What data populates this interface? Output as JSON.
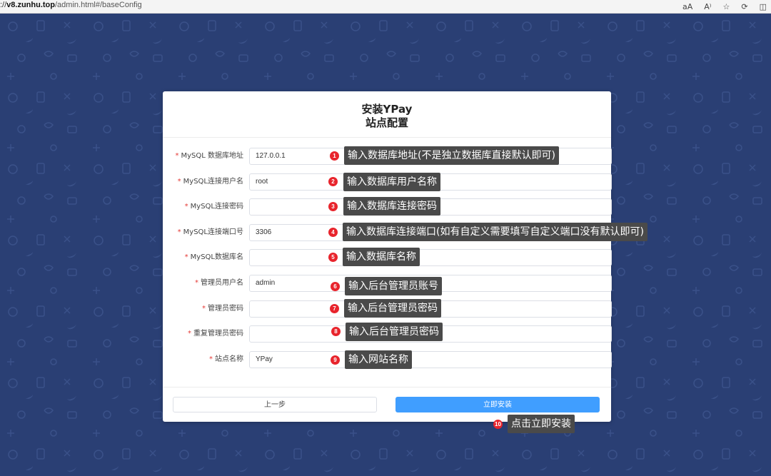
{
  "browser": {
    "url_prefix": "://",
    "url_host": "v8.zunhu.top",
    "url_rest": "/admin.html#/baseConfig",
    "icons": [
      "read-aloud-icon",
      "text-size-icon",
      "favorite-star-icon",
      "extensions-icon",
      "split-screen-icon"
    ]
  },
  "card": {
    "title": "安装YPay",
    "subtitle": "站点配置"
  },
  "form": {
    "required_mark": "*",
    "fields": [
      {
        "label": "MySQL 数据库地址",
        "value": "127.0.0.1"
      },
      {
        "label": "MySQL连接用户名",
        "value": "root"
      },
      {
        "label": "MySQL连接密码",
        "value": ""
      },
      {
        "label": "MySQL连接端口号",
        "value": "3306"
      },
      {
        "label": "MySQL数据库名",
        "value": ""
      },
      {
        "label": "管理员用户名",
        "value": "admin"
      },
      {
        "label": "管理员密码",
        "value": ""
      },
      {
        "label": "重复管理员密码",
        "value": ""
      },
      {
        "label": "站点名称",
        "value": "YPay"
      }
    ]
  },
  "buttons": {
    "prev": "上一步",
    "install": "立即安装"
  },
  "annotations": [
    {
      "num": "1",
      "text": "输入数据库地址(不是独立数据库直接默认即可)"
    },
    {
      "num": "2",
      "text": "输入数据库用户名称"
    },
    {
      "num": "3",
      "text": "输入数据库连接密码"
    },
    {
      "num": "4",
      "text": "输入数据库连接端口(如有自定义需要填写自定义端口没有默认即可)"
    },
    {
      "num": "5",
      "text": "输入数据库名称"
    },
    {
      "num": "6",
      "text": "输入后台管理员账号"
    },
    {
      "num": "7",
      "text": "输入后台管理员密码"
    },
    {
      "num": "8",
      "text": "输入后台管理员密码"
    },
    {
      "num": "9",
      "text": "输入网站名称"
    },
    {
      "num": "10",
      "text": "点击立即安装"
    }
  ],
  "colors": {
    "background": "#2a3f74",
    "primary": "#409eff",
    "required": "#e53935",
    "badge": "#e8242c",
    "tooltip": "#4a4a4a"
  }
}
